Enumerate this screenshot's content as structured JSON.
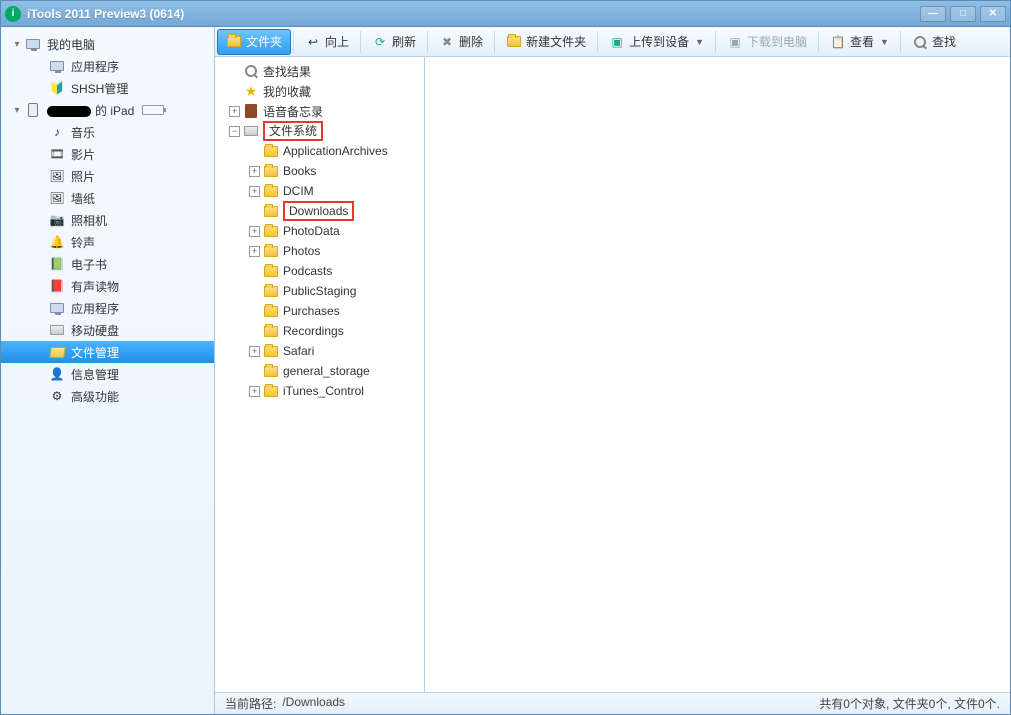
{
  "window": {
    "title": "iTools 2011 Preview3 (0614)"
  },
  "sidebar": {
    "computer": {
      "label": "我的电脑"
    },
    "computer_children": [
      {
        "label": "应用程序",
        "icon": "app"
      },
      {
        "label": "SHSH管理",
        "icon": "shsh"
      }
    ],
    "device": {
      "label_suffix": "的 iPad"
    },
    "device_children": [
      {
        "label": "音乐",
        "icon": "music"
      },
      {
        "label": "影片",
        "icon": "movie"
      },
      {
        "label": "照片",
        "icon": "photo"
      },
      {
        "label": "墙纸",
        "icon": "wallpaper"
      },
      {
        "label": "照相机",
        "icon": "camera"
      },
      {
        "label": "铃声",
        "icon": "ringtone"
      },
      {
        "label": "电子书",
        "icon": "ebook"
      },
      {
        "label": "有声读物",
        "icon": "audiobook"
      },
      {
        "label": "应用程序",
        "icon": "app"
      },
      {
        "label": "移动硬盘",
        "icon": "disk"
      },
      {
        "label": "文件管理",
        "icon": "folder",
        "selected": true
      },
      {
        "label": "信息管理",
        "icon": "info"
      },
      {
        "label": "高级功能",
        "icon": "advanced"
      }
    ]
  },
  "toolbar": {
    "folder": "文件夹",
    "up": "向上",
    "refresh": "刷新",
    "delete": "删除",
    "newfolder": "新建文件夹",
    "upload": "上传到设备",
    "download": "下载到电脑",
    "view": "查看",
    "find": "查找"
  },
  "tree": {
    "search_results": "查找结果",
    "favorites": "我的收藏",
    "voice_memos": "语音备忘录",
    "filesystem": "文件系统",
    "fs_children": [
      {
        "label": "ApplicationArchives",
        "exp": ""
      },
      {
        "label": "Books",
        "exp": "+"
      },
      {
        "label": "DCIM",
        "exp": "+"
      },
      {
        "label": "Downloads",
        "exp": "",
        "highlighted": true
      },
      {
        "label": "PhotoData",
        "exp": "+"
      },
      {
        "label": "Photos",
        "exp": "+"
      },
      {
        "label": "Podcasts",
        "exp": ""
      },
      {
        "label": "PublicStaging",
        "exp": ""
      },
      {
        "label": "Purchases",
        "exp": ""
      },
      {
        "label": "Recordings",
        "exp": ""
      },
      {
        "label": "Safari",
        "exp": "+"
      },
      {
        "label": "general_storage",
        "exp": ""
      },
      {
        "label": "iTunes_Control",
        "exp": "+"
      }
    ]
  },
  "status": {
    "path_label": "当前路径:",
    "path_value": "/Downloads",
    "summary": "共有0个对象, 文件夹0个, 文件0个."
  }
}
